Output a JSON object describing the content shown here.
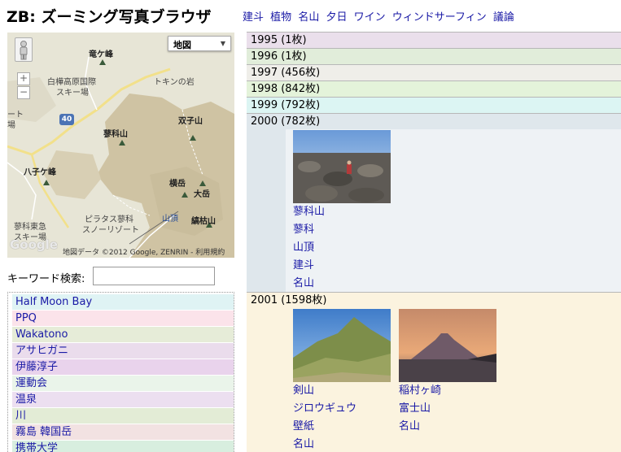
{
  "header": {
    "title": "ZB: ズーミング写真ブラウザ",
    "tags": [
      "建斗",
      "植物",
      "名山",
      "夕日",
      "ワイン",
      "ウィンドサーフィン",
      "議論"
    ]
  },
  "map": {
    "type_selector": "地図",
    "zoom_in": "+",
    "zoom_out": "−",
    "route_number": "40",
    "labels": {
      "ryugamine": "竜ケ峰",
      "shirakaba": "白樺高原国際",
      "ski": "スキー場",
      "tokin": "トキンの岩",
      "tateshina_yama": "蓼科山",
      "futago": "双子山",
      "hachiko": "八子ケ峰",
      "yokodake": "横岳",
      "oodake": "大岳",
      "pilatus1": "ピラタス蓼科",
      "pilatus2": "スノーリゾート",
      "sancho": "山頂",
      "shimagare": "縞枯山",
      "tateshina_tokyu1": "蓼科東急",
      "tateshina_tokyu2": "スキー場",
      "edge1": "ート",
      "edge2": "場"
    },
    "logo": "Google",
    "attribution": "地図データ ©2012 Google, ZENRIN - ",
    "terms": "利用規約"
  },
  "search": {
    "label": "キーワード検索:",
    "placeholder": "",
    "value": ""
  },
  "keywords": [
    {
      "label": "Half Moon Bay",
      "color": "#dff3f4"
    },
    {
      "label": "PPQ",
      "color": "#fbe3ea"
    },
    {
      "label": "Wakatono",
      "color": "#e6ecd8"
    },
    {
      "label": "アサヒガニ",
      "color": "#eadcec"
    },
    {
      "label": "伊藤淳子",
      "color": "#e9d3ec"
    },
    {
      "label": "運動会",
      "color": "#eaf4ea"
    },
    {
      "label": "温泉",
      "color": "#ecdff0"
    },
    {
      "label": "川",
      "color": "#e3ecd6"
    },
    {
      "label": "霧島 韓国岳",
      "color": "#f2e2e2"
    },
    {
      "label": "携帯大学",
      "color": "#d8eedf"
    }
  ],
  "years": [
    {
      "label": "1995 (1枚)",
      "color": "#eadfeb"
    },
    {
      "label": "1996 (1枚)",
      "color": "#e1edda"
    },
    {
      "label": "1997 (456枚)",
      "color": "#efeee9"
    },
    {
      "label": "1998 (842枚)",
      "color": "#e4f3da"
    },
    {
      "label": "1999 (792枚)",
      "color": "#dcf5f3"
    }
  ],
  "year_2000": {
    "label": "2000 (782枚)",
    "color": "#dfe7ec",
    "tags": [
      "蓼科山",
      "蓼科",
      "山頂",
      "建斗",
      "名山"
    ]
  },
  "year_2001": {
    "label": "2001 (1598枚)",
    "color": "#fbf3df",
    "col1_tags": [
      "剣山",
      "ジロウギュウ",
      "壁紙",
      "名山"
    ],
    "col2_tags": [
      "稲村ヶ崎",
      "富士山",
      "名山"
    ]
  }
}
